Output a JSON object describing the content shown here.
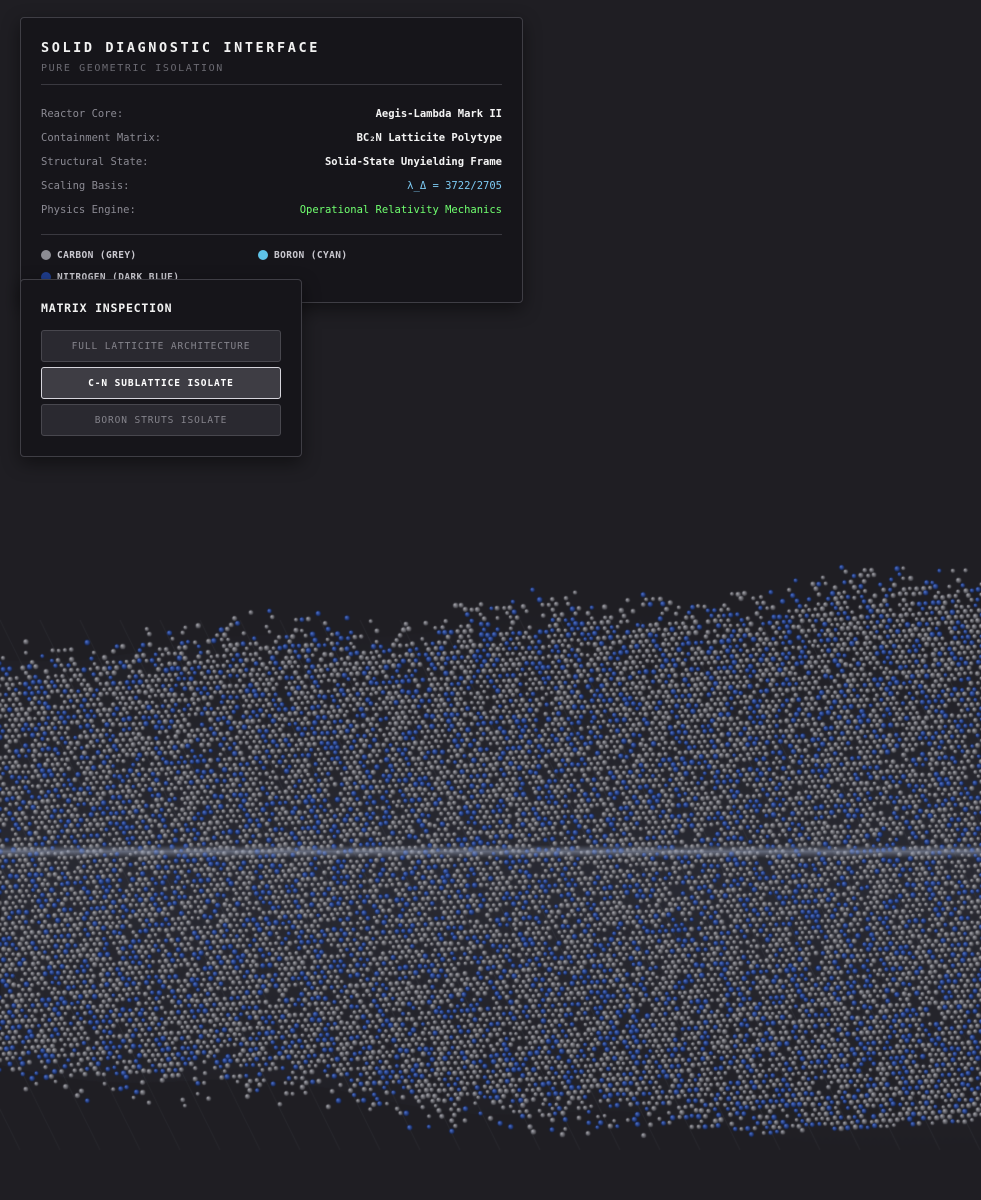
{
  "diagnostic": {
    "title": "SOLID DIAGNOSTIC INTERFACE",
    "subtitle": "PURE GEOMETRIC ISOLATION",
    "rows": [
      {
        "label": "Reactor Core:",
        "value": "Aegis-Lambda Mark II"
      },
      {
        "label": "Containment Matrix:",
        "value": "BC₂N Latticite Polytype"
      },
      {
        "label": "Structural State:",
        "value": "Solid-State Unyielding Frame"
      },
      {
        "label": "Scaling Basis:",
        "value": "λ_Δ = 3722/2705"
      },
      {
        "label": "Physics Engine:",
        "value": "Operational Relativity Mechanics"
      }
    ],
    "legend": [
      {
        "label": "CARBON (GREY)",
        "color": "#8c8c93"
      },
      {
        "label": "BORON (CYAN)",
        "color": "#5ec3e8"
      },
      {
        "label": "NITROGEN (DARK BLUE)",
        "color": "#1f3d8c"
      }
    ],
    "colors": {
      "scaling_value": "#7cc9f2",
      "physics_value": "#6fff6f"
    }
  },
  "matrix_inspection": {
    "heading": "MATRIX INSPECTION",
    "buttons": [
      {
        "label": "FULL LATTICITE ARCHITECTURE",
        "active": false
      },
      {
        "label": "C-N SUBLATTICE ISOLATE",
        "active": true
      },
      {
        "label": "BORON STRUTS ISOLATE",
        "active": false
      }
    ]
  },
  "lattice_view": {
    "visible_species": [
      "carbon",
      "nitrogen"
    ],
    "carbon_color": "#8c8c93",
    "nitrogen_color": "#1f3d8c",
    "background": "#1f1e23"
  }
}
